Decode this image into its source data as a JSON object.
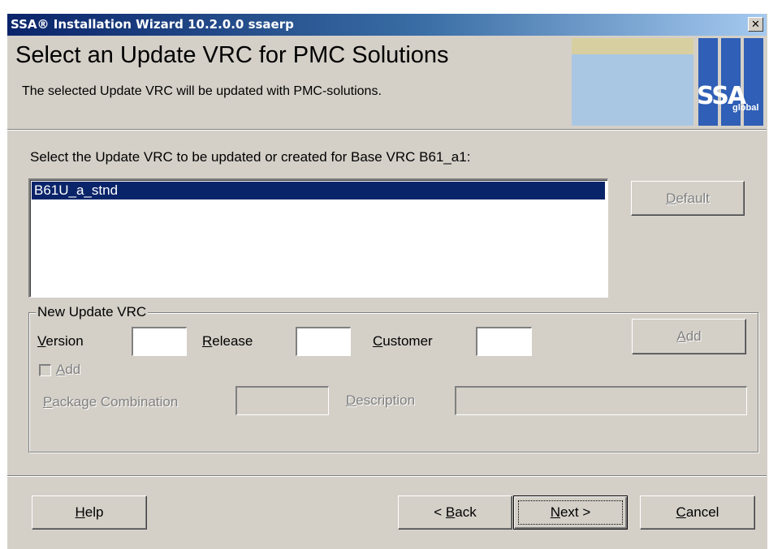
{
  "window": {
    "title": "SSA® Installation Wizard 10.2.0.0 ssaerp",
    "close_symbol": "✕"
  },
  "header": {
    "heading": "Select an Update VRC for PMC Solutions",
    "subtitle": "The selected Update VRC will be updated with PMC-solutions.",
    "logo_text": "SSA",
    "logo_sub": "global"
  },
  "main": {
    "instruction": "Select the Update VRC to be updated or created for Base VRC B61_a1:",
    "list_items": [
      "B61U_a_stnd"
    ],
    "default_button": {
      "mnemonic": "D",
      "rest": "efault"
    }
  },
  "new_vrc": {
    "legend": "New Update VRC",
    "version": {
      "mnemonic": "V",
      "rest": "ersion",
      "value": ""
    },
    "release": {
      "mnemonic": "R",
      "rest": "elease",
      "value": ""
    },
    "customer": {
      "mnemonic": "C",
      "rest": "ustomer",
      "value": ""
    },
    "add_button": {
      "mnemonic": "A",
      "rest": "dd"
    },
    "add_checkbox": {
      "mnemonic": "A",
      "rest": "dd",
      "checked": false
    },
    "package_combination": {
      "mnemonic": "P",
      "rest": "ackage Combination",
      "value": ""
    },
    "description": {
      "mnemonic": "D",
      "rest": "escription",
      "value": ""
    }
  },
  "footer": {
    "help": {
      "mnemonic": "H",
      "rest": "elp"
    },
    "back": {
      "prefix": "< ",
      "mnemonic": "B",
      "rest": "ack"
    },
    "next": {
      "mnemonic": "N",
      "rest": "ext >"
    },
    "cancel": {
      "mnemonic": "C",
      "rest": "ancel"
    }
  },
  "colors": {
    "selection": "#0a246a",
    "face": "#d4d0c8",
    "logo_blue": "#2f5fb6"
  }
}
